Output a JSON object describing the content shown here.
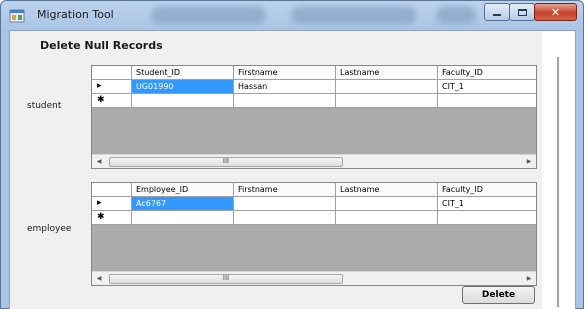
{
  "window": {
    "title": "Migration Tool"
  },
  "form": {
    "heading": "Delete Null Records",
    "delete_label": "Delete"
  },
  "student_grid": {
    "label": "student",
    "columns": [
      "Student_ID",
      "Firstname",
      "Lastname",
      "Faculty_ID"
    ],
    "rows": [
      {
        "marker": "▸",
        "cells": [
          "UG01990",
          "Hassan",
          "",
          "CIT_1"
        ]
      },
      {
        "marker": "✱",
        "cells": [
          "",
          "",
          "",
          ""
        ]
      }
    ],
    "scroll_grip": "III"
  },
  "employee_grid": {
    "label": "employee",
    "columns": [
      "Employee_ID",
      "Firstname",
      "Lastname",
      "Faculty_ID"
    ],
    "rows": [
      {
        "marker": "▸",
        "cells": [
          "Ac6767",
          "",
          "",
          "CIT_1"
        ]
      },
      {
        "marker": "✱",
        "cells": [
          "",
          "",
          "",
          ""
        ]
      }
    ],
    "scroll_grip": "III"
  },
  "colors": {
    "selection": "#3399ff",
    "grid_background": "#ababab",
    "close_button": "#c4442b"
  },
  "icons": {
    "app": "app-window-icon",
    "minimize": "minimize-icon",
    "maximize": "maximize-icon",
    "close": "close-icon"
  }
}
